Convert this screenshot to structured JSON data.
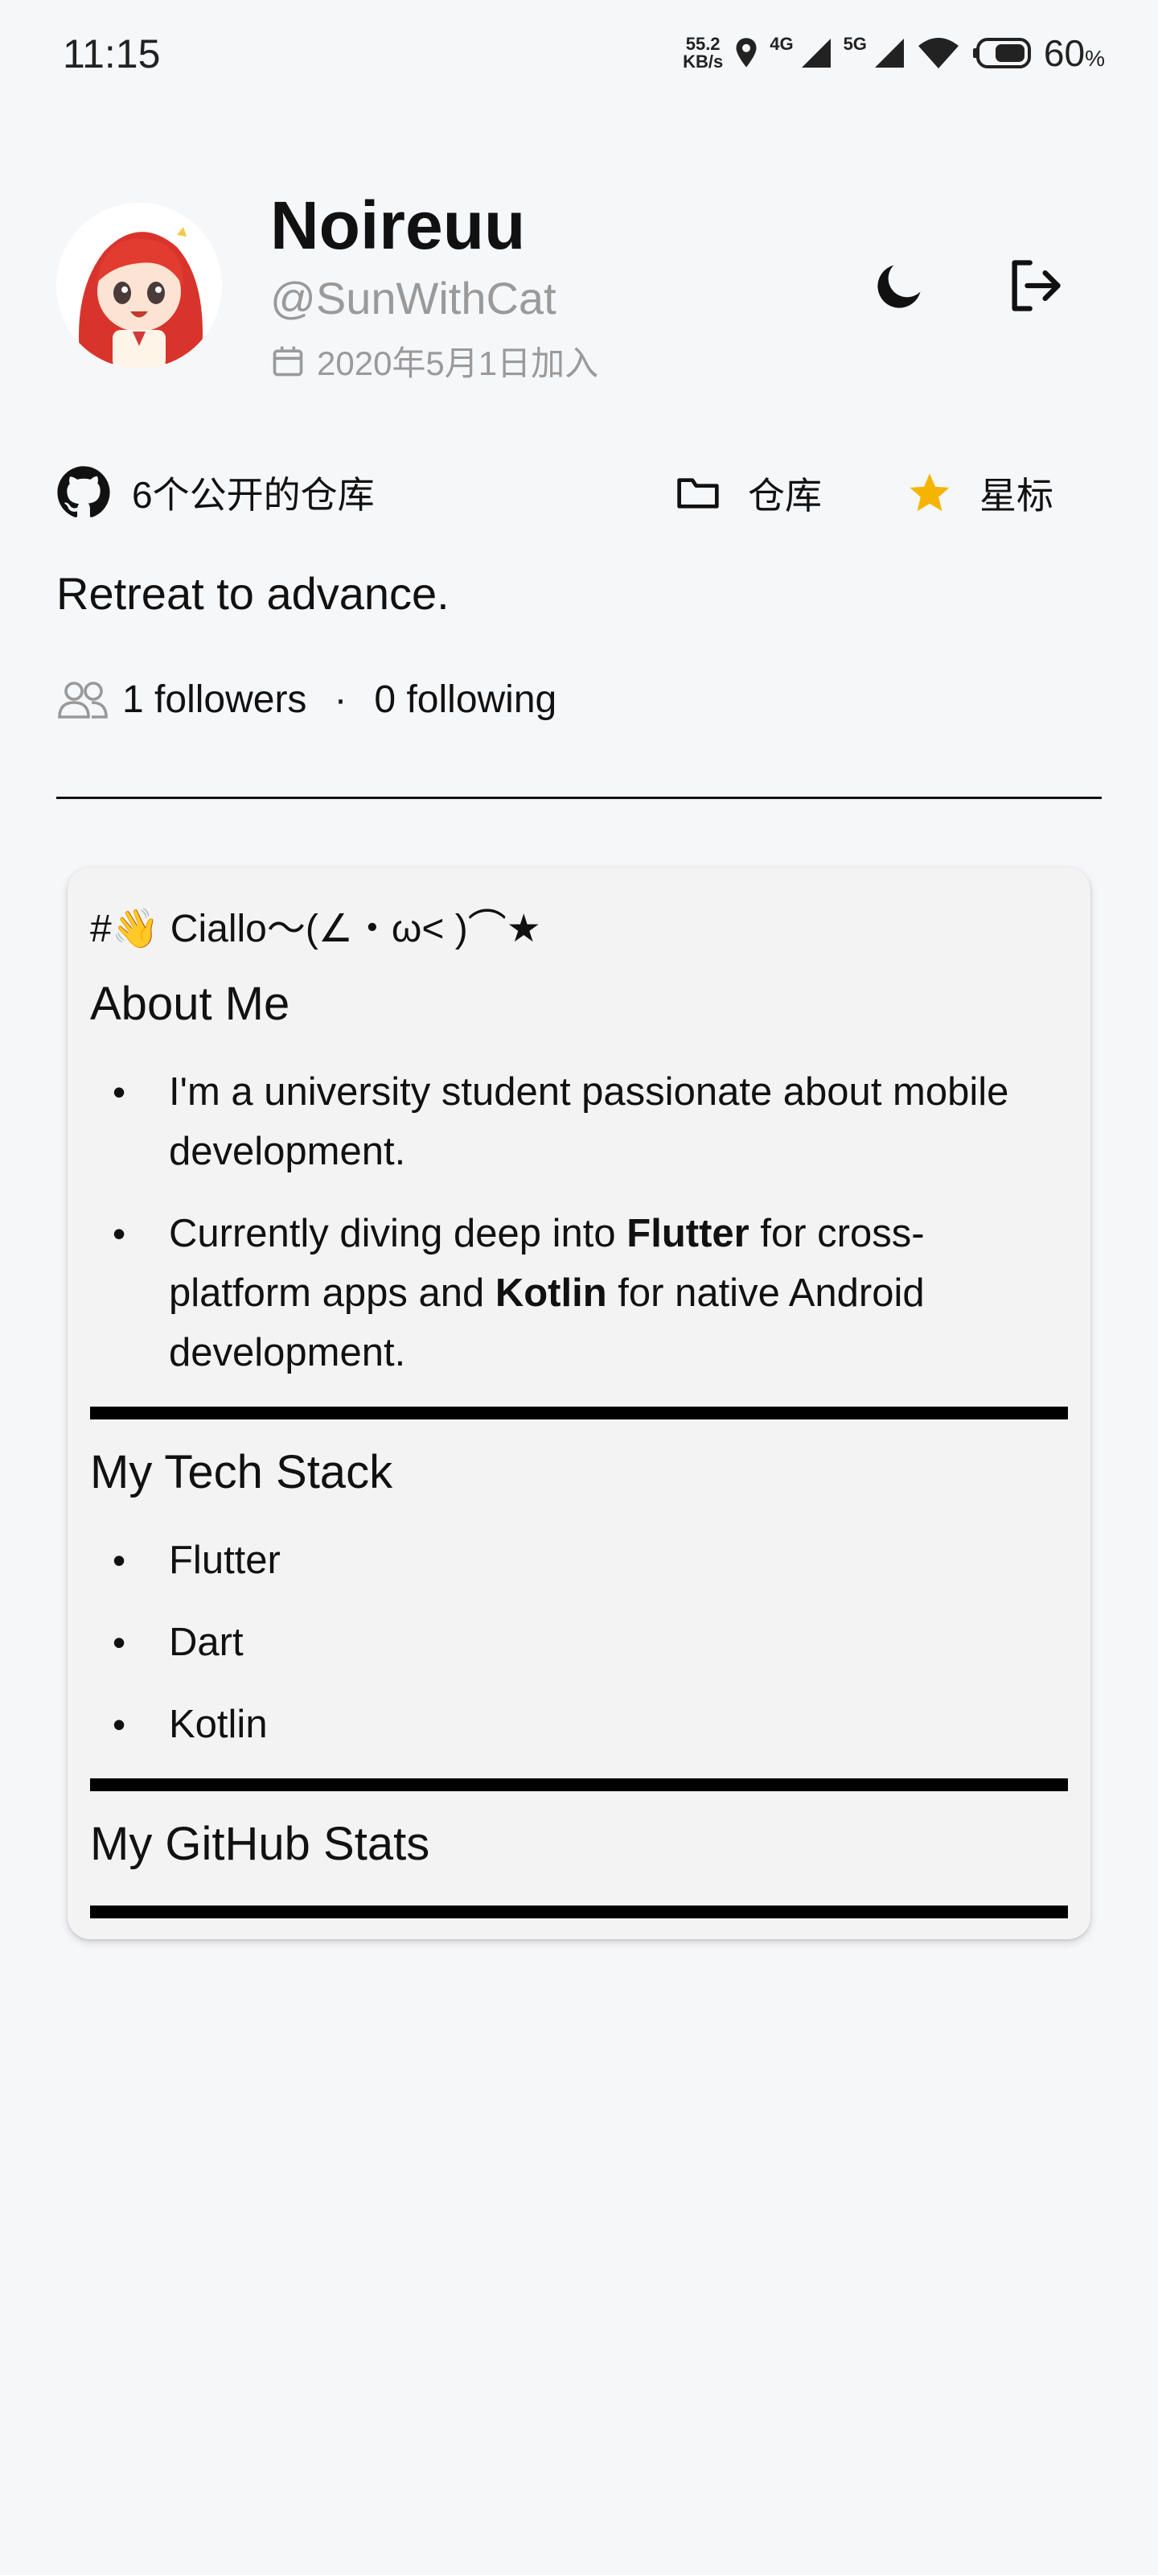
{
  "status_bar": {
    "time": "11:15",
    "net_speed_value": "55.2",
    "net_speed_unit": "KB/s",
    "signal1": "4G",
    "signal2": "5G",
    "battery": "60",
    "battery_unit": "%"
  },
  "profile": {
    "name": "Noireuu",
    "handle": "@SunWithCat",
    "joined": "2020年5月1日加入",
    "public_repos": "6个公开的仓库",
    "repos_label": "仓库",
    "stars_label": "星标",
    "bio": "Retreat to advance.",
    "followers": "1 followers",
    "separator": "·",
    "following": "0 following"
  },
  "readme": {
    "title": "#👋 Ciallo～(∠・ω< )⌒★",
    "about_heading": "About Me",
    "about_item1": "I'm a university student passionate about mobile development.",
    "about_item2_a": "Currently diving deep into ",
    "about_item2_b": "Flutter",
    "about_item2_c": " for cross-platform apps and ",
    "about_item2_d": "Kotlin",
    "about_item2_e": " for native Android development.",
    "stack_heading": "My Tech Stack",
    "stack_items": [
      "Flutter",
      "Dart",
      "Kotlin"
    ],
    "stats_heading": "My GitHub Stats"
  },
  "icons": {
    "theme": "moon-icon",
    "logout": "logout-icon",
    "github": "github-icon",
    "folder": "folder-icon",
    "star": "star-icon",
    "calendar": "calendar-icon",
    "people": "people-icon"
  },
  "colors": {
    "background": "#f6f7f9",
    "star": "#f5b400",
    "muted_text": "#9a9a9a",
    "card": "#f3f3f3"
  }
}
